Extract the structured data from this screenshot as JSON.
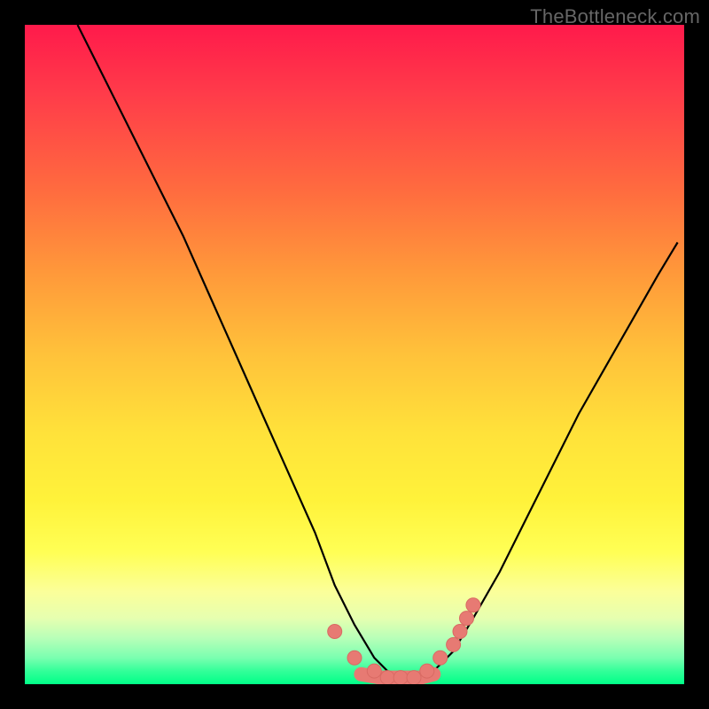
{
  "watermark": "TheBottleneck.com",
  "colors": {
    "frame": "#000000",
    "curve": "#000000",
    "marker_fill": "#e77a73",
    "marker_stroke": "#d96a63",
    "gradient_top": "#ff1a4b",
    "gradient_bottom": "#00ff88"
  },
  "chart_data": {
    "type": "line",
    "title": "",
    "xlabel": "",
    "ylabel": "",
    "xlim": [
      0,
      100
    ],
    "ylim": [
      0,
      100
    ],
    "grid": false,
    "legend": false,
    "series": [
      {
        "name": "bottleneck-curve",
        "x": [
          8,
          12,
          16,
          20,
          24,
          28,
          32,
          36,
          40,
          44,
          47,
          50,
          53,
          55,
          57,
          59,
          62,
          65,
          68,
          72,
          76,
          80,
          84,
          88,
          92,
          96,
          99
        ],
        "y": [
          100,
          92,
          84,
          76,
          68,
          59,
          50,
          41,
          32,
          23,
          15,
          9,
          4,
          2,
          1,
          1,
          2,
          5,
          10,
          17,
          25,
          33,
          41,
          48,
          55,
          62,
          67
        ]
      }
    ],
    "markers": [
      {
        "x": 47,
        "y": 8
      },
      {
        "x": 50,
        "y": 4
      },
      {
        "x": 53,
        "y": 2
      },
      {
        "x": 55,
        "y": 1
      },
      {
        "x": 57,
        "y": 1
      },
      {
        "x": 59,
        "y": 1
      },
      {
        "x": 61,
        "y": 2
      },
      {
        "x": 63,
        "y": 4
      },
      {
        "x": 65,
        "y": 6
      },
      {
        "x": 66,
        "y": 8
      },
      {
        "x": 67,
        "y": 10
      },
      {
        "x": 68,
        "y": 12
      }
    ],
    "bottom_band": [
      {
        "x": 51,
        "y": 1.5
      },
      {
        "x": 54,
        "y": 1
      },
      {
        "x": 57,
        "y": 1
      },
      {
        "x": 60,
        "y": 1
      },
      {
        "x": 62,
        "y": 1.5
      }
    ]
  }
}
